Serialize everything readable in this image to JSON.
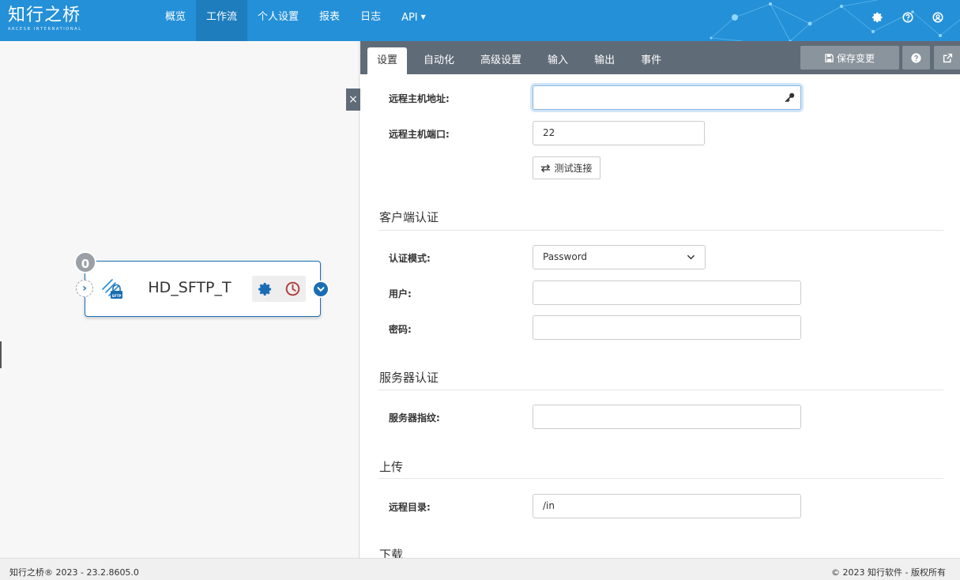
{
  "header": {
    "logo_text": "知行之桥",
    "logo_sub": "ARCESB INTERNATIONAL",
    "nav": [
      {
        "label": "概览"
      },
      {
        "label": "工作流"
      },
      {
        "label": "个人设置"
      },
      {
        "label": "报表"
      },
      {
        "label": "日志"
      },
      {
        "label": "API"
      }
    ],
    "icons": [
      "gear-icon",
      "help-icon",
      "user-icon"
    ]
  },
  "canvas": {
    "close_label": "×",
    "node": {
      "badge": "0",
      "title": "HD_SFTP_T",
      "icon": "sftp-icon",
      "action_icons": [
        "gear-icon",
        "clock-icon"
      ]
    }
  },
  "panel": {
    "tabs": [
      {
        "label": "设置"
      },
      {
        "label": "自动化"
      },
      {
        "label": "高级设置"
      },
      {
        "label": "输入"
      },
      {
        "label": "输出"
      },
      {
        "label": "事件"
      }
    ],
    "save_label": "保存变更",
    "fields": {
      "host_label": "远程主机地址:",
      "host_value": "",
      "port_label": "远程主机端口:",
      "port_value": "22",
      "test_label": "测试连接",
      "client_auth_title": "客户端认证",
      "auth_mode_label": "认证模式:",
      "auth_mode_value": "Password",
      "user_label": "用户:",
      "user_value": "",
      "password_label": "密码:",
      "password_value": "",
      "server_auth_title": "服务器认证",
      "fingerprint_label": "服务器指纹:",
      "fingerprint_value": "",
      "upload_title": "上传",
      "remote_dir_label": "远程目录:",
      "remote_dir_value": "/in",
      "download_title": "下载"
    }
  },
  "footer": {
    "left": "知行之桥® 2023 - 23.2.8605.0",
    "right": "© 2023 知行软件 - 版权所有"
  },
  "colors": {
    "topbar": "#2490d8",
    "nav_active": "#1e7dbd",
    "tabbar": "#5f6b77",
    "node_border": "#1a6db3"
  }
}
